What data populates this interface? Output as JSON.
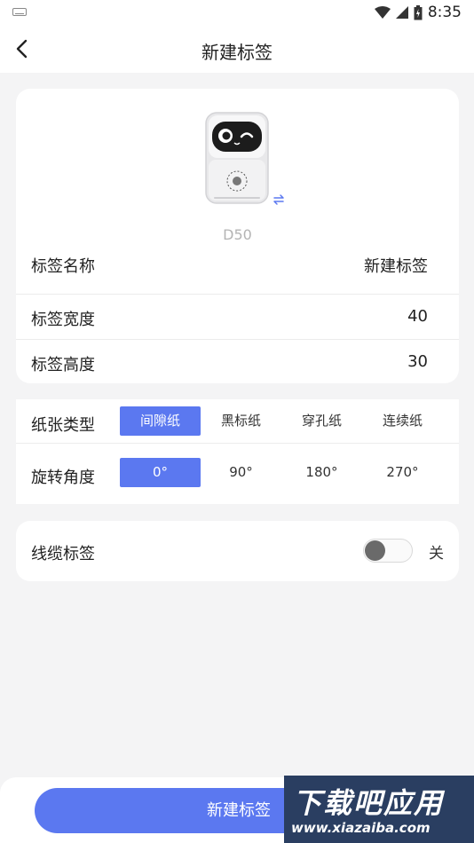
{
  "status_bar": {
    "time": "8:35",
    "icons": [
      "keyboard-icon",
      "wifi-icon",
      "cell-signal-icon",
      "battery-icon"
    ]
  },
  "nav": {
    "title": "新建标签",
    "back_icon": "back-arrow-icon"
  },
  "printer": {
    "name": "D50",
    "image_icon": "printer-image",
    "switch_icon": "swap-icon"
  },
  "fields": [
    {
      "label": "标签名称",
      "value": "新建标签"
    },
    {
      "label": "标签宽度",
      "value": "40"
    },
    {
      "label": "标签高度",
      "value": "30"
    }
  ],
  "paper_type": {
    "label": "纸张类型",
    "options": [
      "间隙纸",
      "黑标纸",
      "穿孔纸",
      "连续纸"
    ],
    "selected": "间隙纸"
  },
  "rotation": {
    "label": "旋转角度",
    "options": [
      "0°",
      "90°",
      "180°",
      "270°"
    ],
    "selected": "0°"
  },
  "cable_label": {
    "label": "线缆标签",
    "state_text": "关",
    "enabled": false
  },
  "create_button": {
    "label": "新建标签"
  },
  "watermark": {
    "cn": "下载吧应用",
    "url": "www.xiazaiba.com"
  },
  "colors": {
    "accent": "#5b78f0",
    "background": "#f4f4f5",
    "card": "#ffffff",
    "muted_text": "#b4b4b4"
  }
}
